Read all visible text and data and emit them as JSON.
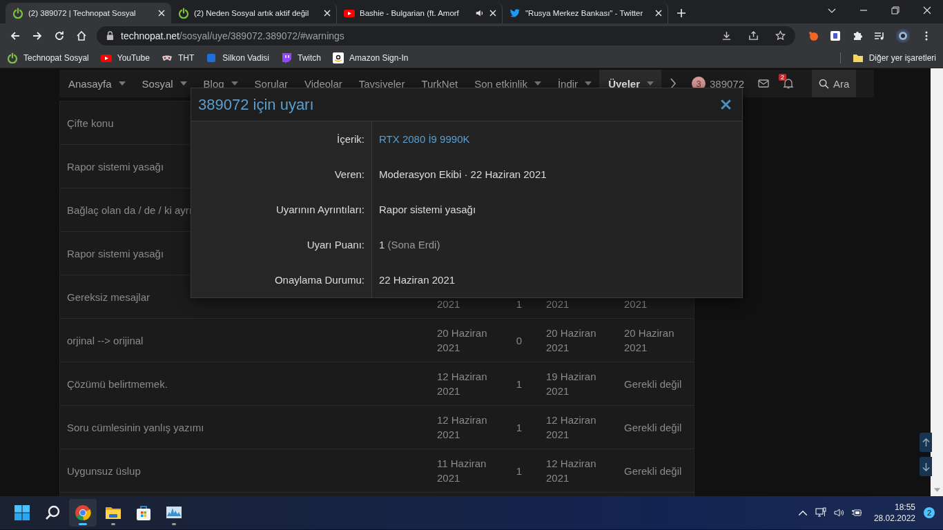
{
  "browser": {
    "tabs": [
      {
        "title": "(2) 389072 | Technopat Sosyal",
        "kind": "power",
        "selected": true,
        "audio": false
      },
      {
        "title": "(2) Neden Sosyal artık aktif değil",
        "kind": "power",
        "selected": false,
        "audio": false
      },
      {
        "title": "Bashie - Bulgarian (ft. Amorf",
        "kind": "video",
        "selected": false,
        "audio": true
      },
      {
        "title": "\"Rusya Merkez Bankası\" - Twitter",
        "kind": "bird",
        "selected": false,
        "audio": false
      }
    ],
    "url_host": "technopat.net",
    "url_path": "/sosyal/uye/389072.389072/#warnings",
    "bookmarks": [
      {
        "label": "Technopat Sosyal",
        "kind": "power"
      },
      {
        "label": "YouTube",
        "kind": "video"
      },
      {
        "label": "THT",
        "kind": "mask"
      },
      {
        "label": "Silkon Vadisi",
        "kind": "square"
      },
      {
        "label": "Twitch",
        "kind": "chat"
      },
      {
        "label": "Amazon Sign-In",
        "kind": "smile"
      }
    ],
    "other_bookmarks": "Diğer yer işaretleri"
  },
  "nav": {
    "items": [
      {
        "label": "Anasayfa",
        "dropdown": true,
        "selected": false
      },
      {
        "label": "Sosyal",
        "dropdown": true,
        "selected": false
      },
      {
        "label": "Blog",
        "dropdown": true,
        "selected": false
      },
      {
        "label": "Sorular",
        "dropdown": false,
        "selected": false
      },
      {
        "label": "Videolar",
        "dropdown": false,
        "selected": false
      },
      {
        "label": "Tavsiyeler",
        "dropdown": false,
        "selected": false
      },
      {
        "label": "TurkNet",
        "dropdown": false,
        "selected": false
      },
      {
        "label": "Son etkinlik",
        "dropdown": true,
        "selected": false
      },
      {
        "label": "İndir",
        "dropdown": true,
        "selected": false
      },
      {
        "label": "Üyeler",
        "dropdown": true,
        "selected": true
      }
    ],
    "avatar_letter": "3",
    "username": "389072",
    "alerts_badge": "2",
    "search_label": "Ara"
  },
  "table": {
    "rows": [
      {
        "title": "Çifte konu"
      },
      {
        "title": "Rapor sistemi yasağı"
      },
      {
        "title": "Bağlaç olan da / de / ki ayrı"
      },
      {
        "title": "Rapor sistemi yasağı"
      },
      {
        "title": "Gereksiz mesajlar",
        "cells": [
          "2021",
          "1",
          "2021",
          "2021"
        ],
        "cut_top": true
      },
      {
        "title": "orjinal --> orijinal",
        "cells": [
          "20 Haziran 2021",
          "0",
          "20 Haziran 2021",
          "20 Haziran 2021"
        ],
        "cut_top": false
      },
      {
        "title": "Çözümü belirtmemek.",
        "cells": [
          "12 Haziran 2021",
          "1",
          "19 Haziran 2021",
          "Gerekli değil"
        ],
        "cut_top": false
      },
      {
        "title": "Soru cümlesinin yanlış yazımı",
        "cells": [
          "12 Haziran 2021",
          "1",
          "12 Haziran 2021",
          "Gerekli değil"
        ],
        "cut_top": false
      },
      {
        "title": "Uygunsuz üslup",
        "cells": [
          "11 Haziran 2021",
          "1",
          "12 Haziran 2021",
          "Gerekli değil"
        ],
        "cut_top": false
      }
    ]
  },
  "modal": {
    "title": "389072 için uyarı",
    "fields": [
      {
        "label": "İçerik:",
        "value": "RTX 2080 İ9 9990K",
        "kind": "link"
      },
      {
        "label": "Veren:",
        "value": "Moderasyon Ekibi · 22 Haziran 2021",
        "kind": "text"
      },
      {
        "label": "Uyarının Ayrıntıları:",
        "value": "Rapor sistemi yasağı",
        "kind": "text"
      },
      {
        "label": "Uyarı Puanı:",
        "value": "1",
        "note": "(Sona Erdi)",
        "kind": "points"
      },
      {
        "label": "Onaylama Durumu:",
        "value": "22 Haziran 2021",
        "kind": "text"
      }
    ]
  },
  "taskbar": {
    "apps": [
      {
        "kind": "start",
        "running": false,
        "selected": false
      },
      {
        "kind": "search",
        "running": false,
        "selected": false
      },
      {
        "kind": "browser",
        "running": true,
        "selected": true
      },
      {
        "kind": "folder",
        "running": true,
        "selected": false
      },
      {
        "kind": "store",
        "running": false,
        "selected": false
      },
      {
        "kind": "monitor",
        "running": true,
        "selected": false
      }
    ],
    "time": "18:55",
    "date": "28.02.2022",
    "notifications": "2"
  }
}
